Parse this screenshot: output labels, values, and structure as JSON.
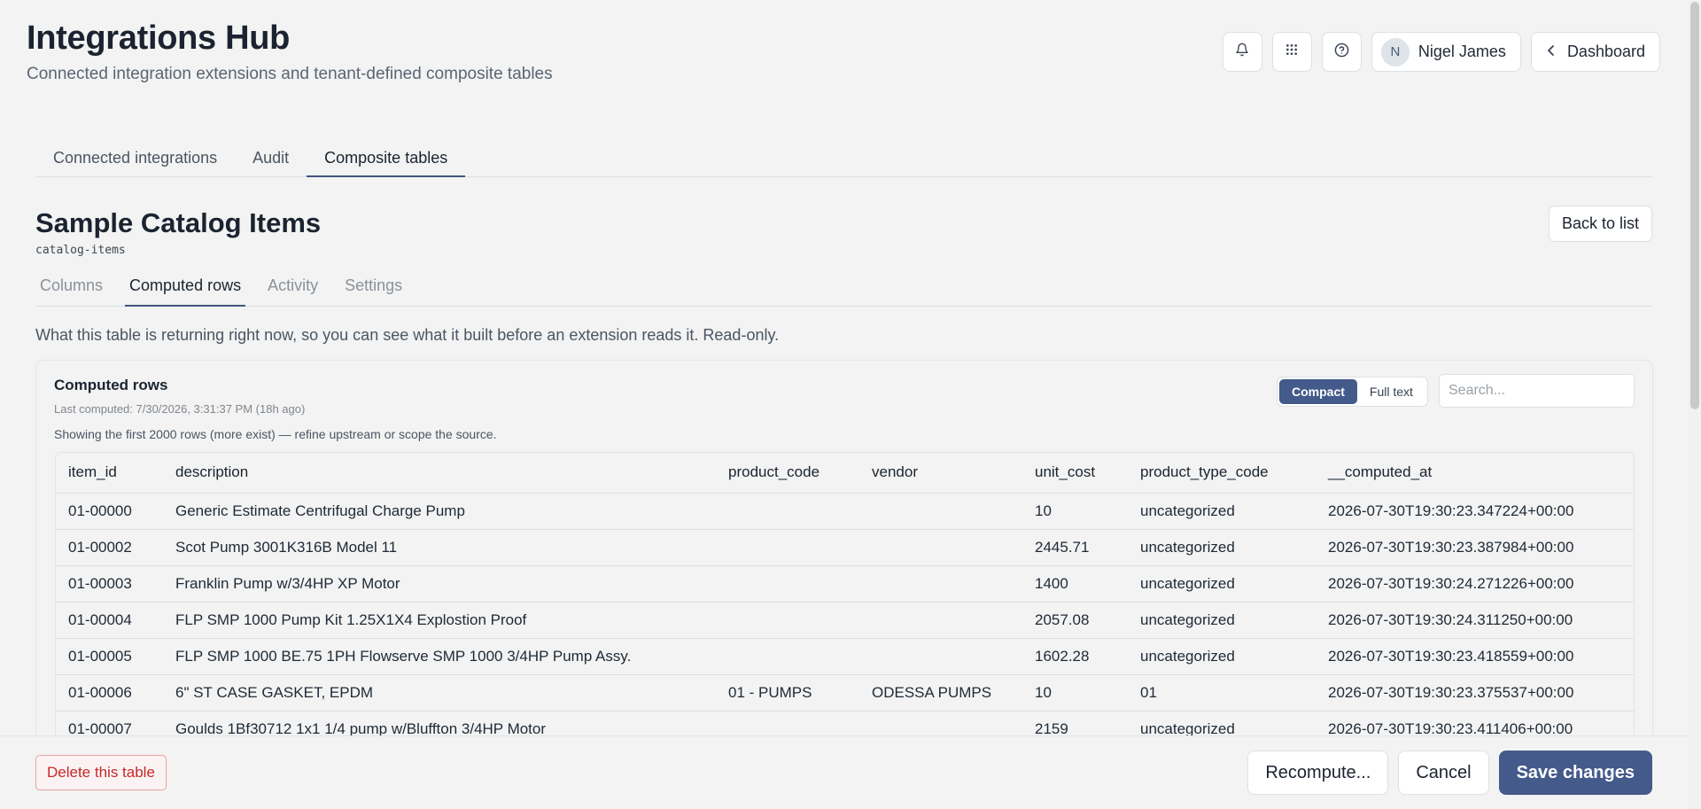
{
  "header": {
    "title": "Integrations Hub",
    "subtitle": "Connected integration extensions and tenant-defined composite tables"
  },
  "top_actions": {
    "icons": [
      "bell-icon",
      "apps-grid-icon",
      "help-icon"
    ],
    "user": {
      "initial": "N",
      "name": "Nigel James"
    },
    "dashboard_label": "Dashboard"
  },
  "main_tabs": [
    {
      "label": "Connected integrations",
      "active": false
    },
    {
      "label": "Audit",
      "active": false
    },
    {
      "label": "Composite tables",
      "active": true
    }
  ],
  "table": {
    "title": "Sample Catalog Items",
    "slug": "catalog-items",
    "back_label": "Back to list"
  },
  "sub_tabs": [
    {
      "label": "Columns",
      "active": false
    },
    {
      "label": "Computed rows",
      "active": true
    },
    {
      "label": "Activity",
      "active": false
    },
    {
      "label": "Settings",
      "active": false
    }
  ],
  "intro_text": "What this table is returning right now, so you can see what it built before an extension reads it. Read-only.",
  "card": {
    "title": "Computed rows",
    "last_computed": "Last computed: 7/30/2026, 3:31:37 PM (18h ago)",
    "note": "Showing the first 2000 rows (more exist) — refine upstream or scope the source.",
    "view_options": [
      "Compact",
      "Full text"
    ],
    "view_selected": "Compact",
    "search_placeholder": "Search...",
    "search_value": ""
  },
  "grid": {
    "columns": [
      "item_id",
      "description",
      "product_code",
      "vendor",
      "unit_cost",
      "product_type_code",
      "__computed_at"
    ],
    "rows": [
      [
        "01-00000",
        "Generic Estimate Centrifugal Charge Pump",
        "",
        "",
        "10",
        "uncategorized",
        "2026-07-30T19:30:23.347224+00:00"
      ],
      [
        "01-00002",
        "Scot Pump 3001K316B Model 11",
        "",
        "",
        "2445.71",
        "uncategorized",
        "2026-07-30T19:30:23.387984+00:00"
      ],
      [
        "01-00003",
        "Franklin Pump w/3/4HP XP Motor",
        "",
        "",
        "1400",
        "uncategorized",
        "2026-07-30T19:30:24.271226+00:00"
      ],
      [
        "01-00004",
        "FLP SMP 1000 Pump Kit 1.25X1X4 Explostion Proof",
        "",
        "",
        "2057.08",
        "uncategorized",
        "2026-07-30T19:30:24.311250+00:00"
      ],
      [
        "01-00005",
        "FLP SMP 1000 BE.75 1PH Flowserve SMP 1000 3/4HP Pump Assy.",
        "",
        "",
        "1602.28",
        "uncategorized",
        "2026-07-30T19:30:23.418559+00:00"
      ],
      [
        "01-00006",
        "6\" ST CASE GASKET, EPDM",
        "01 - PUMPS",
        "ODESSA PUMPS",
        "10",
        "01",
        "2026-07-30T19:30:23.375537+00:00"
      ],
      [
        "01-00007",
        "Goulds 1Bf30712 1x1 1/4 pump w/Bluffton 3/4HP Motor",
        "",
        "",
        "2159",
        "uncategorized",
        "2026-07-30T19:30:23.411406+00:00"
      ]
    ]
  },
  "footer": {
    "delete_label": "Delete this table",
    "recompute_label": "Recompute...",
    "cancel_label": "Cancel",
    "save_label": "Save changes"
  }
}
